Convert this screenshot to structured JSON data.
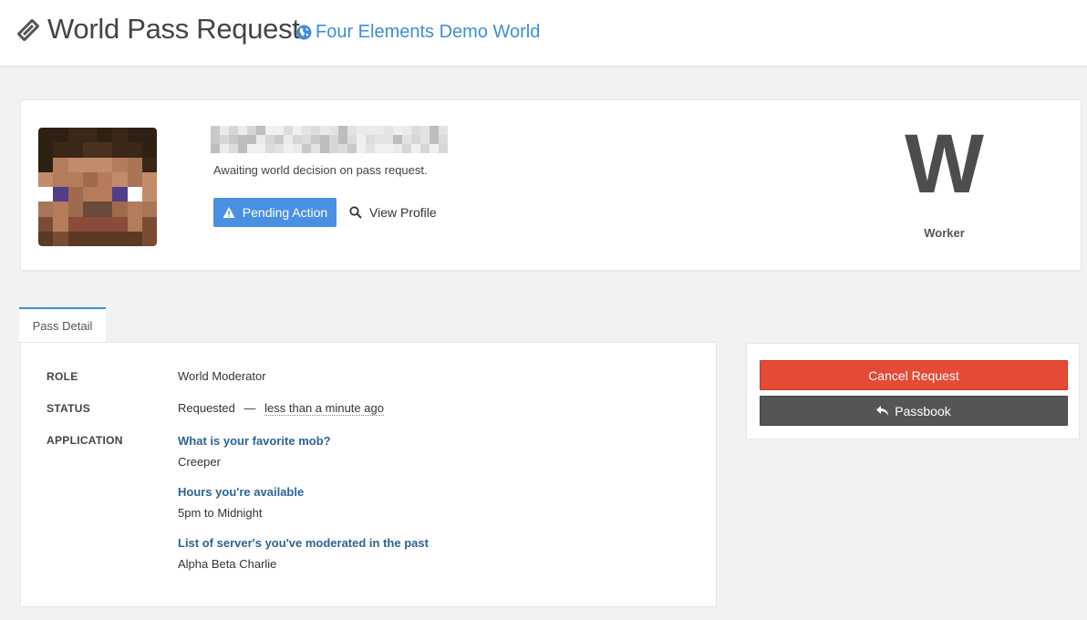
{
  "header": {
    "title": "World Pass Request",
    "world_link": "Four Elements Demo World"
  },
  "profile": {
    "avatar_icon": "minecraft-steve-avatar",
    "status_message": "Awaiting world decision on pass request.",
    "pending_label": "Pending Action",
    "view_profile_label": "View Profile",
    "role_letter": "W",
    "role_name": "Worker"
  },
  "tabs": [
    {
      "label": "Pass Detail",
      "active": true
    }
  ],
  "details": {
    "role_label": "ROLE",
    "role_value": "World Moderator",
    "status_label": "STATUS",
    "status_value": "Requested",
    "status_separator": "—",
    "status_time": "less than a minute ago",
    "application_label": "APPLICATION",
    "application": [
      {
        "question": "What is your favorite mob?",
        "answer": "Creeper"
      },
      {
        "question": "Hours you're available",
        "answer": "5pm to Midnight"
      },
      {
        "question": "List of server's you've moderated in the past",
        "answer": "Alpha Beta Charlie"
      }
    ]
  },
  "actions": {
    "cancel_label": "Cancel Request",
    "passbook_label": "Passbook"
  },
  "colors": {
    "accent": "#3d8fd6",
    "pending": "#4a90e2",
    "cancel": "#e54a35",
    "passbook": "#555555",
    "question": "#2a6496"
  }
}
